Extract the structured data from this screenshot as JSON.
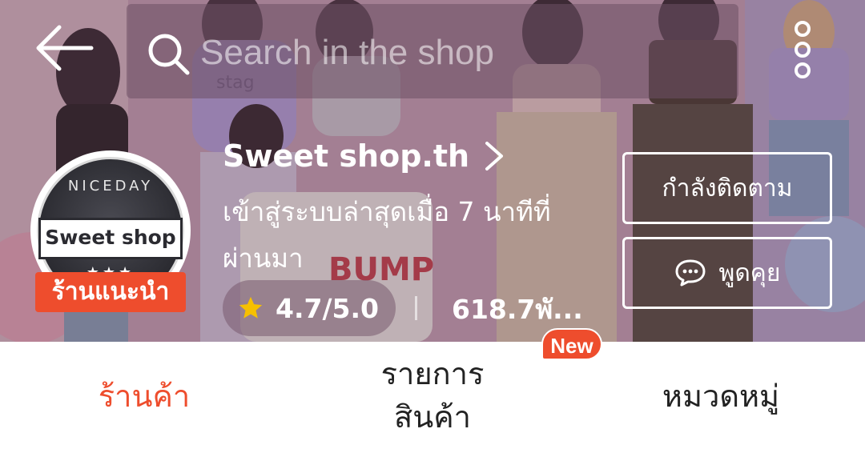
{
  "colors": {
    "accent": "#ee4d2d",
    "white": "#ffffff",
    "text_dark": "#222222",
    "star": "#f6c000"
  },
  "header": {
    "search_placeholder": "Search in the shop",
    "back_icon": "arrow-left-icon",
    "more_icon": "more-vertical-icon"
  },
  "shop": {
    "name": "Sweet shop.th",
    "last_seen": "เข้าสู่ระบบล่าสุดเมื่อ 7 นาทีที่ผ่านมา",
    "badge": "ร้านแนะนำ",
    "rating": "4.7/5.0",
    "followers": "618.7พั...",
    "logo": {
      "ring_text": "NICEDAY",
      "banner_text": "Sweet shop",
      "stars": "★★★"
    }
  },
  "actions": {
    "follow_label": "กำลังติดตาม",
    "chat_label": "พูดคุย"
  },
  "tabs": [
    {
      "label": "ร้านค้า",
      "active": true
    },
    {
      "label": "รายการสินค้า",
      "line1": "รายการ",
      "line2": "สินค้า",
      "badge": "New"
    },
    {
      "label": "หมวดหมู่"
    }
  ]
}
